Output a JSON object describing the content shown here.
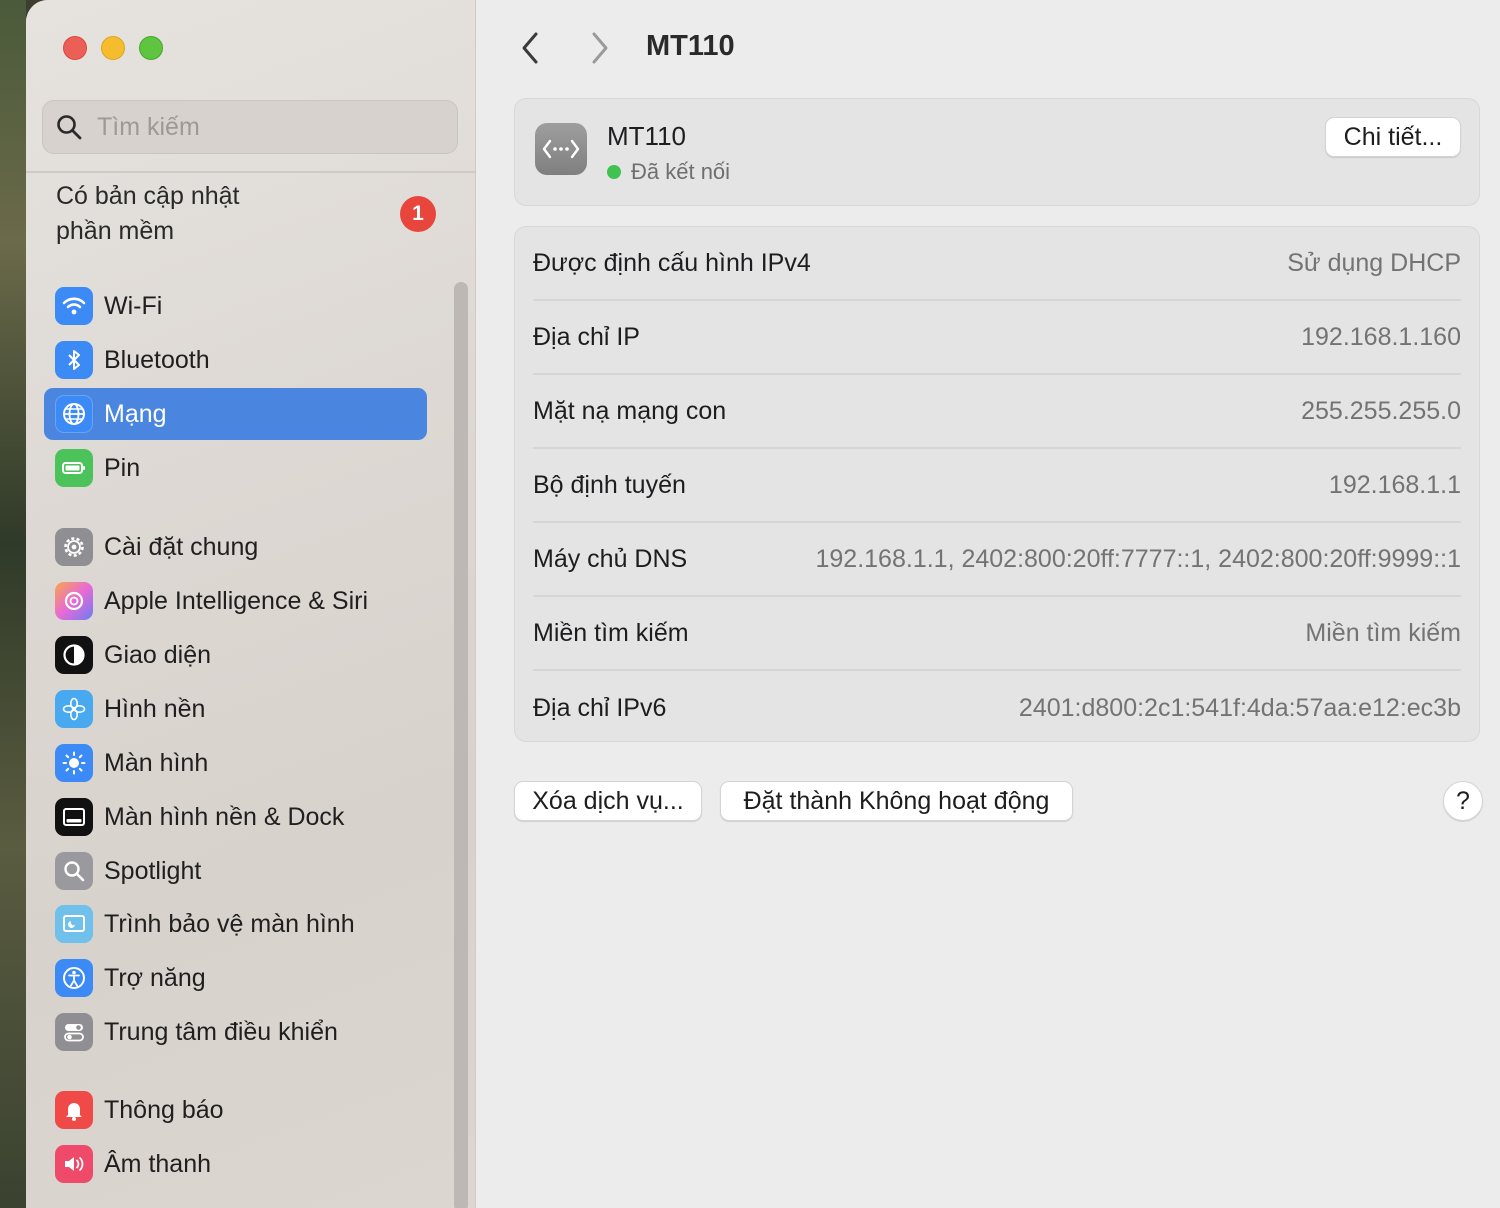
{
  "window": {
    "title": "MT110"
  },
  "search": {
    "placeholder": "Tìm kiếm"
  },
  "update": {
    "line1": "Có bản cập nhật",
    "line2": "phần mềm",
    "badge": "1"
  },
  "sidebar": {
    "items": [
      {
        "label": "Wi-Fi",
        "icon": "wifi-icon",
        "color": "#3c8af5",
        "active": false
      },
      {
        "label": "Bluetooth",
        "icon": "bluetooth-icon",
        "color": "#3c8af5",
        "active": false
      },
      {
        "label": "Mạng",
        "icon": "globe-icon",
        "color": "#3c8af5",
        "active": true
      },
      {
        "label": "Pin",
        "icon": "battery-icon",
        "color": "#4cc25a",
        "active": false
      },
      {
        "label": "Cài đặt chung",
        "icon": "gear-icon",
        "color": "#8e8e93",
        "active": false
      },
      {
        "label": "Apple Intelligence & Siri",
        "icon": "siri-icon",
        "color": "#e86ad6",
        "active": false
      },
      {
        "label": "Giao diện",
        "icon": "appearance-icon",
        "color": "#111111",
        "active": false
      },
      {
        "label": "Hình nền",
        "icon": "flower-icon",
        "color": "#48a8f0",
        "active": false
      },
      {
        "label": "Màn hình",
        "icon": "sun-icon",
        "color": "#3c8af5",
        "active": false
      },
      {
        "label": "Màn hình nền & Dock",
        "icon": "dock-icon",
        "color": "#111111",
        "active": false
      },
      {
        "label": "Spotlight",
        "icon": "magnifier-icon",
        "color": "#9a9a9e",
        "active": false
      },
      {
        "label": "Trình bảo vệ màn hình",
        "icon": "screensaver-icon",
        "color": "#6fc0ea",
        "active": false
      },
      {
        "label": "Trợ năng",
        "icon": "accessibility-icon",
        "color": "#3c8af5",
        "active": false
      },
      {
        "label": "Trung tâm điều khiển",
        "icon": "toggles-icon",
        "color": "#8e8e93",
        "active": false
      },
      {
        "label": "Thông báo",
        "icon": "bell-icon",
        "color": "#ef4a48",
        "active": false
      },
      {
        "label": "Âm thanh",
        "icon": "speaker-icon",
        "color": "#ef4a6a",
        "active": false
      }
    ]
  },
  "service": {
    "name": "MT110",
    "status": "Đã kết nối",
    "status_color": "#3fc24f",
    "details_button": "Chi tiết..."
  },
  "details": {
    "rows": [
      {
        "label": "Được định cấu hình IPv4",
        "value": "Sử dụng DHCP"
      },
      {
        "label": "Địa chỉ IP",
        "value": "192.168.1.160"
      },
      {
        "label": "Mặt nạ mạng con",
        "value": "255.255.255.0"
      },
      {
        "label": "Bộ định tuyến",
        "value": "192.168.1.1"
      },
      {
        "label": "Máy chủ DNS",
        "value": "192.168.1.1, 2402:800:20ff:7777::1, 2402:800:20ff:9999::1"
      },
      {
        "label": "Miền tìm kiếm",
        "value": "Miền tìm kiếm"
      },
      {
        "label": "Địa chỉ IPv6",
        "value": "2401:d800:2c1:541f:4da:57aa:e12:ec3b"
      }
    ]
  },
  "actions": {
    "delete_service": "Xóa dịch vụ...",
    "make_inactive": "Đặt thành Không hoạt động",
    "help": "?"
  }
}
